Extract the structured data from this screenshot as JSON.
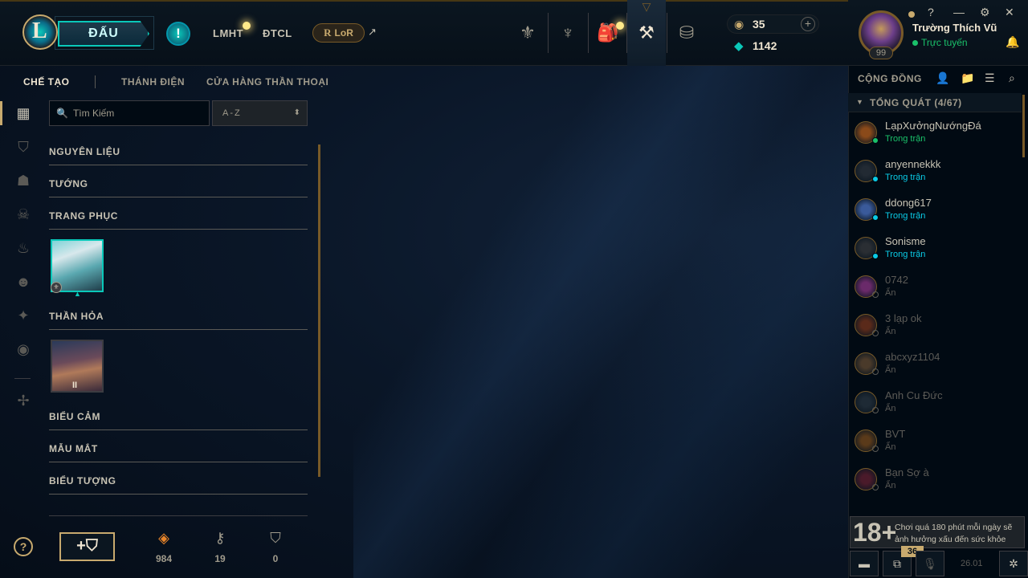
{
  "topbar": {
    "play_label": "ĐẤU",
    "game_tabs": [
      "LMHT",
      "ĐTCL"
    ],
    "lor_label": "LoR",
    "rp_value": "35",
    "be_value": "1142",
    "nav_icons": [
      "trophy-icon",
      "clash-icon",
      "store-bag-icon",
      "crafting-icon",
      "coins-icon"
    ]
  },
  "profile": {
    "name": "Trường Thích Vũ",
    "status": "Trực tuyến",
    "level": "99"
  },
  "window_controls": [
    "?",
    "—",
    "✕"
  ],
  "subnav": {
    "tabs": [
      "CHẾ TẠO",
      "THÁNH ĐIỆN",
      "CỬA HÀNG THẦN THOẠI"
    ],
    "active": "CHẾ TẠO"
  },
  "search": {
    "placeholder": "Tìm Kiếm",
    "sort_value": "A-Z"
  },
  "categories": [
    "NGUYÊN LIỆU",
    "TƯỚNG",
    "TRANG PHỤC",
    "THẦN HỎA",
    "BIỂU CẢM",
    "MẪU MẮT",
    "BIỂU TƯỢNG"
  ],
  "emporium_tile_label": "II",
  "loot_counts": {
    "orange_essence": "984",
    "keys": "19",
    "chests": "0"
  },
  "social": {
    "header": "CỘNG ĐỒNG",
    "group_title": "TỔNG QUÁT (4/67)",
    "friends": [
      {
        "name": "LạpXưởngNướngĐá",
        "status": "Trong trận"
      },
      {
        "name": "anyennekkk",
        "status": "Trong trận"
      },
      {
        "name": "ddong617",
        "status": "Trong trận"
      },
      {
        "name": "Sonisme",
        "status": "Trong trận"
      },
      {
        "name": "0742",
        "status": "Ẩn"
      },
      {
        "name": "3 lạp ok",
        "status": "Ẩn"
      },
      {
        "name": "abcxyz1104",
        "status": "Ẩn"
      },
      {
        "name": "Anh Cu Đức",
        "status": "Ẩn"
      },
      {
        "name": "BVT",
        "status": "Ẩn"
      },
      {
        "name": "Bạn Sợ à",
        "status": "Ẩn"
      }
    ],
    "age_rating": "18+",
    "age_warning": "Chơi quá 180 phút mỗi ngày sẽ ảnh hưởng xấu đến sức khỏe",
    "notif_count": "36",
    "version": "26.01"
  },
  "colors": {
    "gold": "#c8aa6e",
    "teal": "#0ac8b9",
    "online_green": "#1ac16a",
    "ingame_teal": "#0acbe6"
  }
}
